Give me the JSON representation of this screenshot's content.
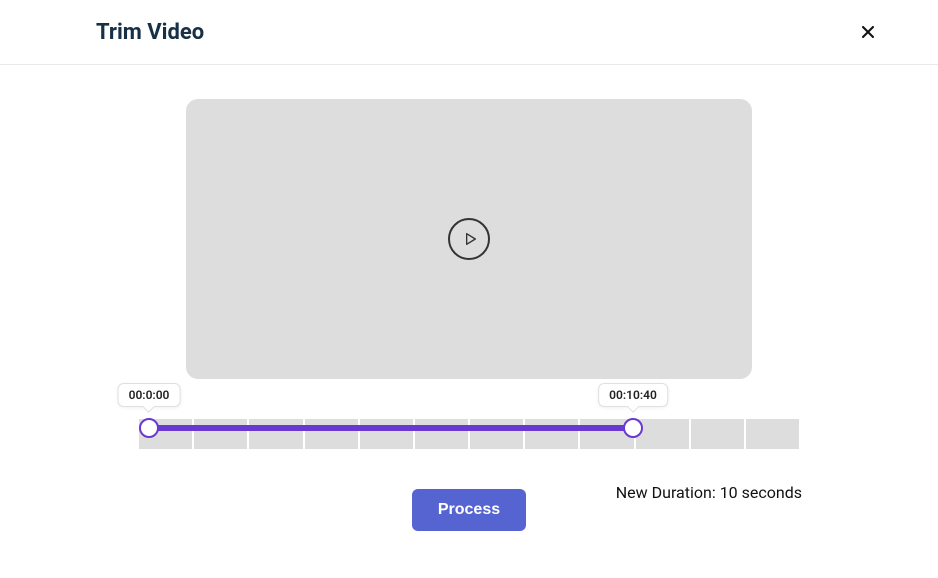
{
  "header": {
    "title": "Trim Video"
  },
  "slider": {
    "start_label": "00:0:00",
    "end_label": "00:10:40"
  },
  "footer": {
    "duration_text": "New Duration: 10 seconds",
    "process_label": "Process"
  }
}
